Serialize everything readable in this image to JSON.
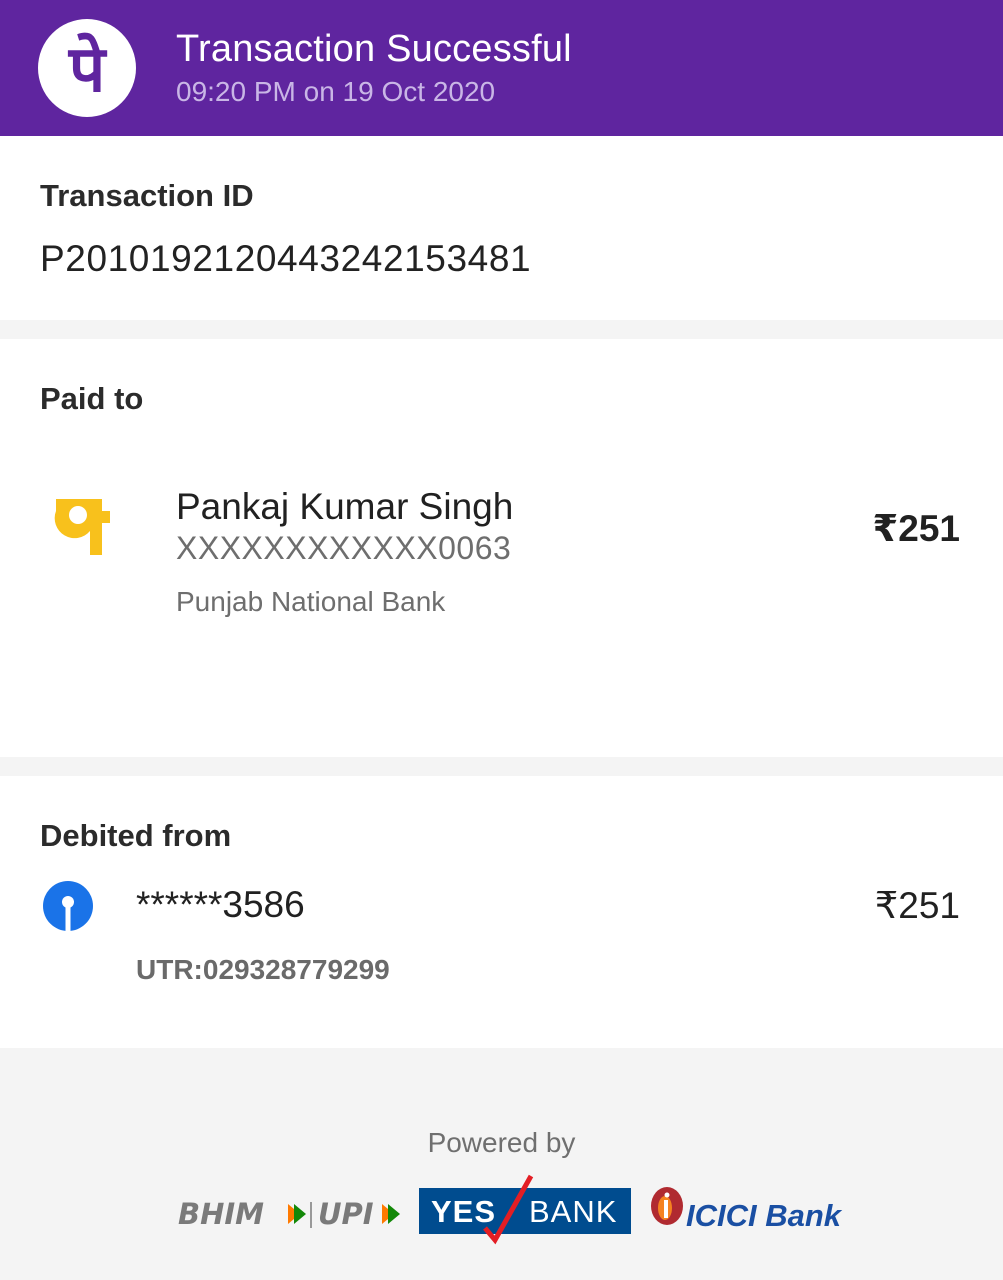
{
  "header": {
    "title": "Transaction Successful",
    "subtitle": "09:20 PM on 19 Oct 2020",
    "logo_icon": "phonepe-logo-icon",
    "background_color": "#5f259f"
  },
  "transaction": {
    "label": "Transaction ID",
    "id": "P2010192120443242153481"
  },
  "paid_to": {
    "label": "Paid to",
    "name": "Pankaj Kumar Singh",
    "account": "XXXXXXXXXXXX0063",
    "bank": "Punjab National Bank",
    "amount": "₹251",
    "bank_icon": "pnb-logo-icon"
  },
  "debited_from": {
    "label": "Debited from",
    "account": "******3586",
    "amount": "₹251",
    "utr": "UTR:029328779299",
    "bank_icon": "sbi-logo-icon"
  },
  "footer": {
    "powered_by": "Powered by",
    "partners": {
      "bhim": "BHIM",
      "upi": "UPI",
      "yes_bank_1": "YES",
      "yes_bank_2": "BANK",
      "icici": "ICICI Bank"
    }
  }
}
